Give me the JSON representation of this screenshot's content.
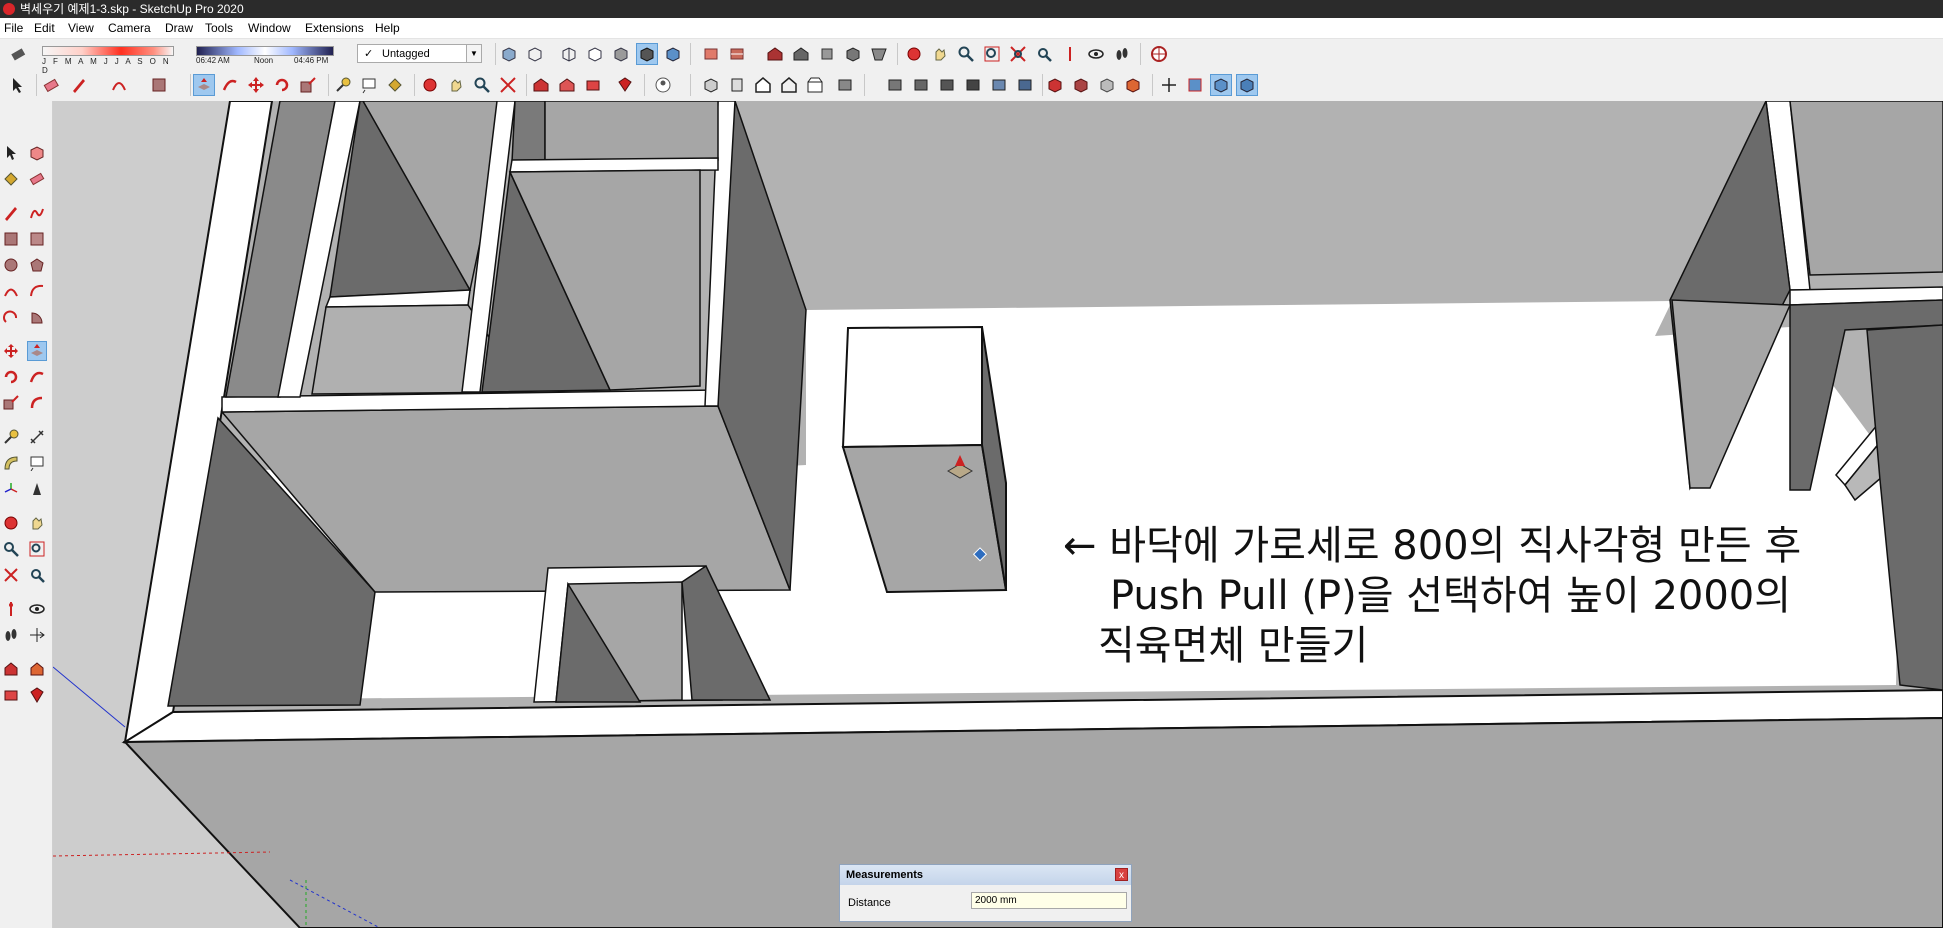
{
  "window": {
    "title": "벽세우기 예제1-3.skp - SketchUp Pro 2020"
  },
  "menu": {
    "items": [
      "File",
      "Edit",
      "View",
      "Camera",
      "Draw",
      "Tools",
      "Window",
      "Extensions",
      "Help"
    ]
  },
  "shadow_settings": {
    "months": "J F M A M J J A S O N D",
    "time_start": "06:42 AM",
    "time_mid": "Noon",
    "time_end": "04:46 PM"
  },
  "tag_selector": {
    "value": "Untagged",
    "check": "✓"
  },
  "annotation": {
    "line1": "← 바닥에 가로세로 800의 직사각형 만든 후",
    "line2": "Push Pull (P)을 선택하여 높이 2000의",
    "line3": "직육면체 만들기"
  },
  "measurements": {
    "title": "Measurements",
    "label": "Distance",
    "value": "2000 mm",
    "close": "x"
  },
  "colors": {
    "accent": "#d9262a",
    "highlight": "#9ec8ef",
    "wall_top": "#ffffff",
    "wall_light": "#a6a6a6",
    "wall_dark": "#6b6b6b",
    "floor": "#b4b4b4"
  },
  "icons": [
    "eraser-icon",
    "select-arrow-icon",
    "pencil-icon",
    "arc-icon",
    "rectangle-icon",
    "push-pull-icon",
    "move-icon",
    "rotate-icon",
    "scale-icon",
    "tape-measure-icon",
    "paint-bucket-icon",
    "orbit-icon",
    "pan-icon",
    "zoom-icon",
    "zoom-extents-icon",
    "iso-view-icon",
    "top-view-icon",
    "front-view-icon",
    "x-ray-icon",
    "warehouse-icon",
    "extension-warehouse-icon"
  ]
}
